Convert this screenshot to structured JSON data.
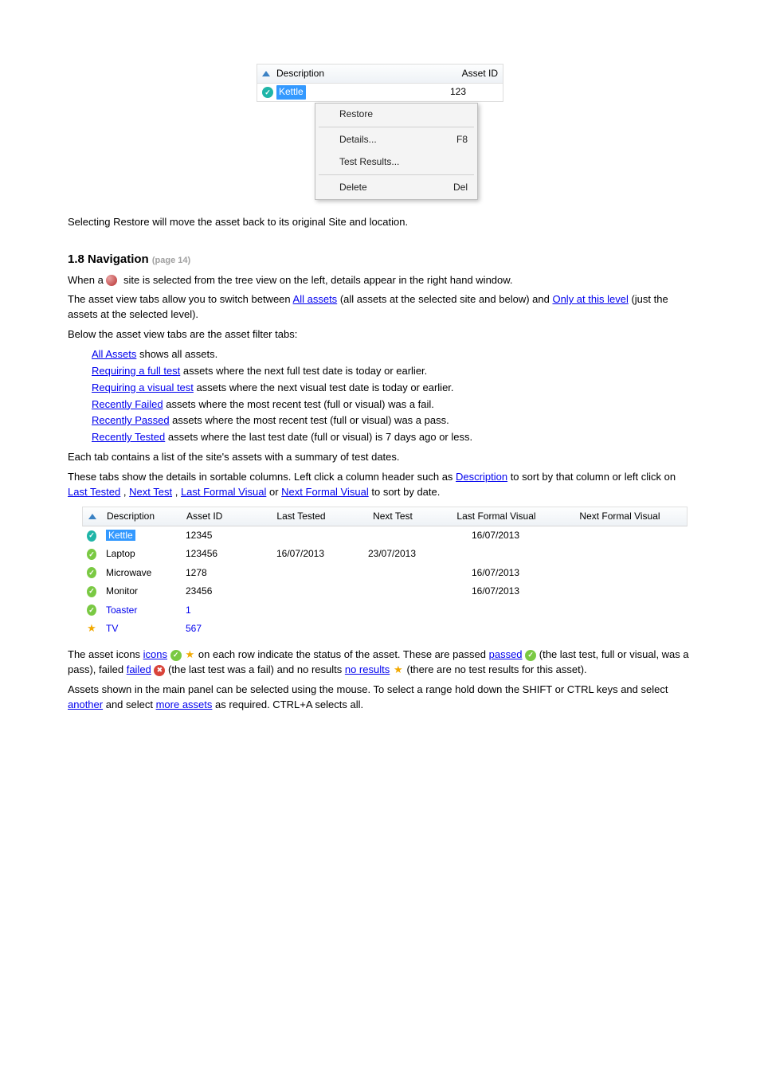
{
  "shot1": {
    "headers": {
      "c1": "Description",
      "c2": "Asset ID"
    },
    "row": {
      "desc": "Kettle",
      "asset_id": "123"
    },
    "menu": {
      "restore": "Restore",
      "details": "Details...",
      "details_sc": "F8",
      "results": "Test Results...",
      "delete": "Delete",
      "delete_sc": "Del"
    }
  },
  "restore_para": "Selecting Restore will move the asset back to its original Site and location.",
  "section_heading": "1.8 Navigation",
  "page_ref": "(page 14)",
  "nav_p1a": "When a ",
  "nav_p1b": " site is selected from the tree view on the left, details appear in the right hand window.",
  "nav_p2a": "The asset view tabs allow you to switch between ",
  "nav_p2b": " (all assets at the selected site and below) and ",
  "nav_p2c": " (just the assets at the selected level).",
  "nav_links": {
    "site": "Site",
    "all_assets": "All assets",
    "only": "Only at this level"
  },
  "nav_p3": "Below the asset view tabs are the asset filter tabs:",
  "tabs": [
    {
      "name": "All Assets",
      "desc": "    shows all assets."
    },
    {
      "name": "Requiring a full test",
      "desc": "    assets where the next full test date is today or earlier."
    },
    {
      "name": "Requiring a visual test",
      "desc": "    assets where the next visual test date is today or earlier."
    },
    {
      "name": "Recently Failed",
      "desc": "    assets where the most recent test (full or visual) was a fail."
    },
    {
      "name": "Recently Passed",
      "desc": "    assets where the most recent test (full or visual) was a pass."
    },
    {
      "name": "Recently Tested",
      "desc": "    assets where the last test date (full or visual) is 7 days ago or less."
    }
  ],
  "main_panel_intro": "Each tab contains a list of the site's assets with a summary of test dates.",
  "tabs_show_cols_1": "These tabs show the details in sortable columns. Left click a column header such as ",
  "tabs_show_cols_2": " to sort by that column or left click on ",
  "tabs_show_cols_3": ", ",
  "tabs_show_cols_4": ", ",
  "tabs_show_cols_5": " or ",
  "tabs_show_cols_6": " to sort by date.",
  "col_links": {
    "desc": "Description",
    "lt": "Last Tested",
    "nt": "Next Test",
    "lfv": "Last Formal Visual",
    "nfv": "Next Formal Visual"
  },
  "shot2": {
    "headers": {
      "desc": "Description",
      "asset": "Asset ID",
      "lt": "Last Tested",
      "nt": "Next Test",
      "lfv": "Last Formal Visual",
      "nfv": "Next Formal Visual"
    },
    "rows": [
      {
        "icon": "check-teal",
        "sel": true,
        "desc": "Kettle",
        "asset": "12345",
        "lt": "",
        "nt": "",
        "lfv": "16/07/2013",
        "nfv": ""
      },
      {
        "icon": "check",
        "sel": false,
        "desc": "Laptop",
        "asset": "123456",
        "lt": "16/07/2013",
        "nt": "23/07/2013",
        "lfv": "",
        "nfv": ""
      },
      {
        "icon": "check",
        "sel": false,
        "desc": "Microwave",
        "asset": "1278",
        "lt": "",
        "nt": "",
        "lfv": "16/07/2013",
        "nfv": ""
      },
      {
        "icon": "check",
        "sel": false,
        "desc": "Monitor",
        "asset": "23456",
        "lt": "",
        "nt": "",
        "lfv": "16/07/2013",
        "nfv": ""
      },
      {
        "icon": "check",
        "sel": false,
        "desc": "Toaster",
        "asset": "1",
        "lt": "",
        "nt": "",
        "lfv": "",
        "nfv": "",
        "link": true
      },
      {
        "icon": "star",
        "sel": false,
        "desc": "TV",
        "asset": "567",
        "lt": "",
        "nt": "",
        "lfv": "",
        "nfv": "",
        "link": true
      }
    ]
  },
  "icons_para_1": "The asset icons ",
  "icons_para_2": " on each row indicate the status of the asset. These are passed ",
  "icons_para_3": " (the last test, full or visual, was a pass), failed ",
  "icons_para_4": " (the last test was a fail) and no results ",
  "icons_para_5": " (there are no test results for this asset).",
  "icon_word_links": {
    "icons": "icons",
    "passed": "passed",
    "failed": "failed",
    "no_results": "no results"
  },
  "failed_icon_glyph": "✖",
  "last_para_1": "Assets shown in the main panel can be selected using the mouse. To select a range hold down the SHIFT or CTRL keys and select ",
  "last_para_2": " and select ",
  "last_para_3": " as required. CTRL+A selects all.",
  "last_links": {
    "another": "another",
    "more_assets": "more assets"
  }
}
